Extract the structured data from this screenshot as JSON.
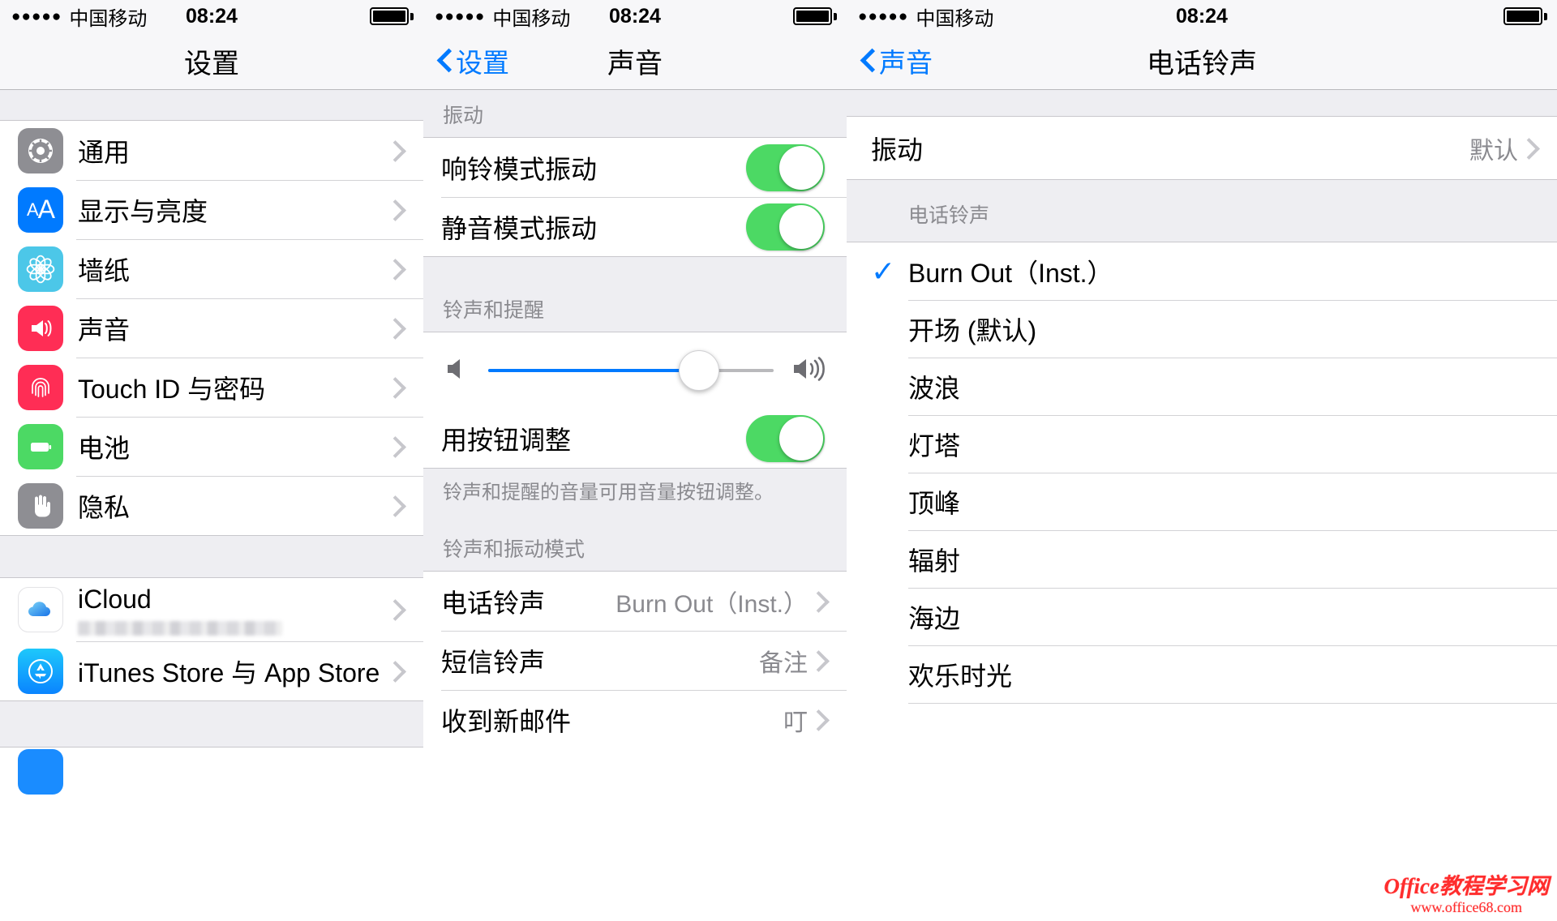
{
  "status_bar": {
    "signal_dots": "●●●●●",
    "carrier": "中国移动",
    "time": "08:24"
  },
  "colors": {
    "accent_blue": "#007aff",
    "toggle_green": "#4cd964",
    "group_bg": "#eeeef2",
    "value_gray": "#8a8a8f",
    "watermark_red": "#ff2d2d"
  },
  "panel_settings": {
    "title": "设置",
    "items": [
      {
        "label": "通用",
        "icon": "gear-icon"
      },
      {
        "label": "显示与亮度",
        "icon": "text-size-icon"
      },
      {
        "label": "墙纸",
        "icon": "wallpaper-flower-icon"
      },
      {
        "label": "声音",
        "icon": "speaker-icon"
      },
      {
        "label": "Touch ID 与密码",
        "icon": "fingerprint-icon"
      },
      {
        "label": "电池",
        "icon": "battery-icon"
      },
      {
        "label": "隐私",
        "icon": "hand-icon"
      }
    ],
    "items_group2": [
      {
        "label": "iCloud",
        "icon": "icloud-icon",
        "subtitle_blurred": true
      },
      {
        "label": "iTunes Store 与 App Store",
        "icon": "appstore-icon"
      }
    ]
  },
  "panel_sounds": {
    "back_label": "设置",
    "title": "声音",
    "section_vibrate": "振动",
    "vibrate_rows": [
      {
        "label": "响铃模式振动",
        "toggle": "on"
      },
      {
        "label": "静音模式振动",
        "toggle": "on"
      }
    ],
    "section_ringer": "铃声和提醒",
    "volume_percent": 74,
    "button_adjust": {
      "label": "用按钮调整",
      "toggle": "on"
    },
    "footer_note": "铃声和提醒的音量可用音量按钮调整。",
    "section_patterns": "铃声和振动模式",
    "pattern_rows": [
      {
        "label": "电话铃声",
        "value": "Burn Out（Inst.）"
      },
      {
        "label": "短信铃声",
        "value": "备注"
      },
      {
        "label": "收到新邮件",
        "value": "叮"
      }
    ]
  },
  "panel_ringtone": {
    "back_label": "声音",
    "title": "电话铃声",
    "vibration_row": {
      "label": "振动",
      "value": "默认"
    },
    "section_ringtone": "电话铃声",
    "check_glyph": "✓",
    "tones": [
      {
        "label": "Burn Out（Inst.）",
        "selected": true
      },
      {
        "label": "开场 (默认)",
        "selected": false
      },
      {
        "label": "波浪",
        "selected": false
      },
      {
        "label": "灯塔",
        "selected": false
      },
      {
        "label": "顶峰",
        "selected": false
      },
      {
        "label": "辐射",
        "selected": false
      },
      {
        "label": "海边",
        "selected": false
      },
      {
        "label": "欢乐时光",
        "selected": false
      }
    ]
  },
  "watermark": {
    "line1": "Office教程学习网",
    "line2": "www.office68.com"
  }
}
